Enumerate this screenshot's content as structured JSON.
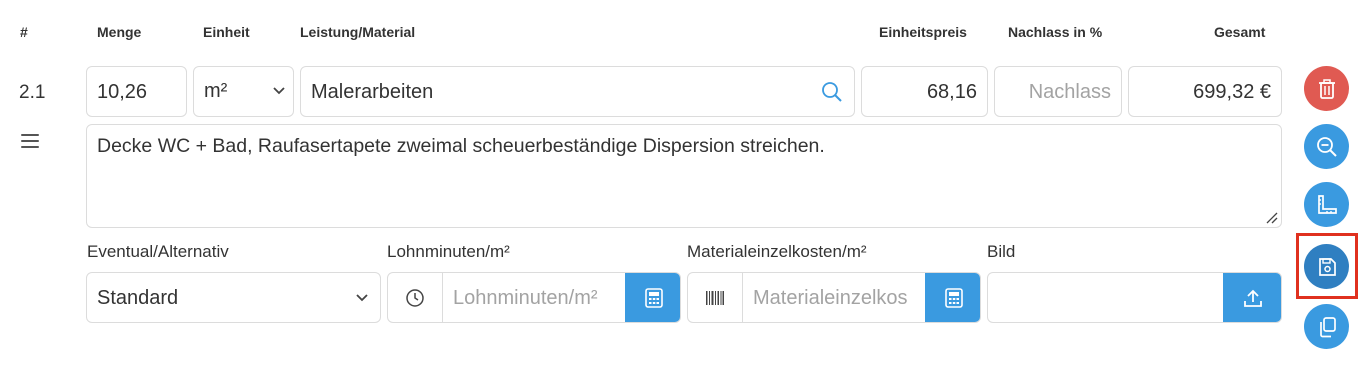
{
  "headers": {
    "num": "#",
    "menge": "Menge",
    "einheit": "Einheit",
    "leistung": "Leistung/Material",
    "einheitspreis": "Einheitspreis",
    "nachlass": "Nachlass in %",
    "gesamt": "Gesamt"
  },
  "row": {
    "number": "2.1",
    "menge": "10,26",
    "einheit": "m²",
    "leistung": "Malerarbeiten",
    "einheitspreis": "68,16",
    "nachlass_placeholder": "Nachlass",
    "gesamt": "699,32 €",
    "description": "Decke WC + Bad, Raufasertapete zweimal scheuerbeständige Dispersion streichen."
  },
  "details": {
    "eventual_label": "Eventual/Alternativ",
    "eventual_value": "Standard",
    "lohn_label": "Lohnminuten/m²",
    "lohn_placeholder": "Lohnminuten/m²",
    "material_label": "Materialeinzelkosten/m²",
    "material_placeholder": "Materialeinzelkos",
    "bild_label": "Bild"
  },
  "actions": [
    "trash-icon",
    "zoom-out-icon",
    "ruler-icon",
    "save-icon",
    "copy-icon"
  ],
  "colors": {
    "blue": "#3a9ae0",
    "red": "#e05a52",
    "save_blue": "#2f7fc1",
    "highlight": "#e0311f"
  }
}
